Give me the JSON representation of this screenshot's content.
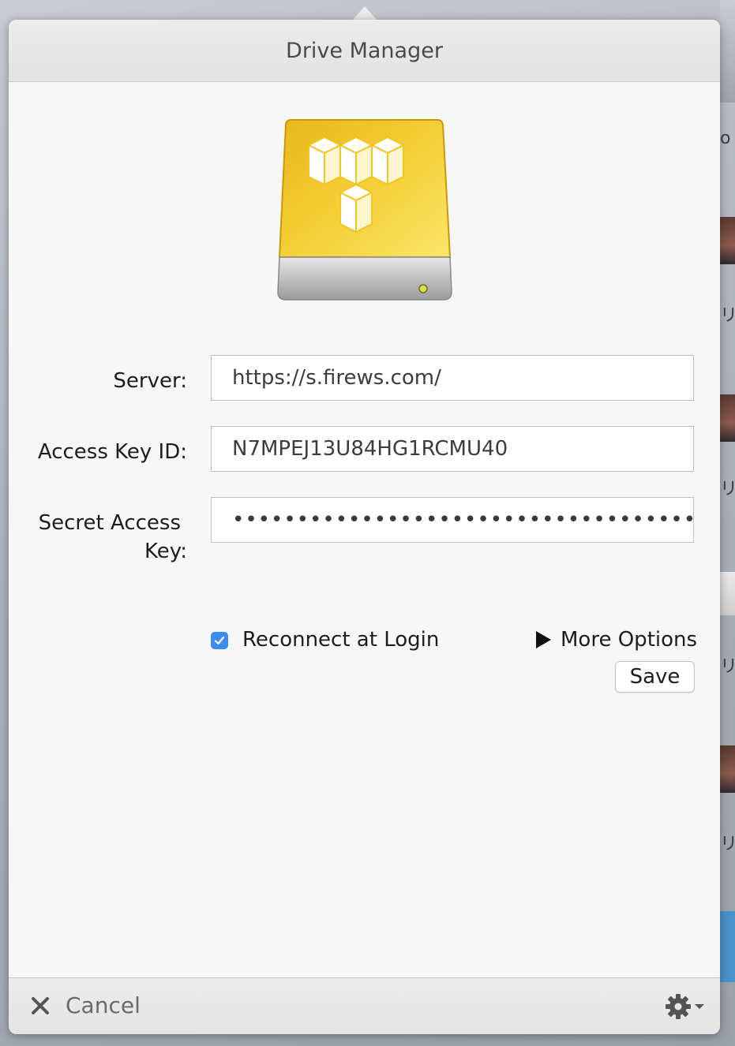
{
  "window": {
    "title": "Drive Manager"
  },
  "form": {
    "server": {
      "label": "Server:",
      "value": "https://s.firews.com/"
    },
    "access_key_id": {
      "label": "Access Key ID:",
      "value": "N7MPEJ13U84HG1RCMU40"
    },
    "secret_access_key": {
      "label_line1": "Secret Access",
      "label_line2": "Key:",
      "masked_value": "•••••••••••••••••••••••••••••••••••••"
    },
    "reconnect": {
      "label": "Reconnect at Login",
      "checked": true
    },
    "more_options": {
      "label": "More Options"
    },
    "save_label": "Save"
  },
  "footer": {
    "cancel_label": "Cancel"
  },
  "icons": {
    "drive": "drive-icon",
    "checkbox": "checkmark-icon",
    "disclosure": "disclosure-triangle-icon",
    "cancel": "close-icon",
    "settings": "gear-icon"
  },
  "colors": {
    "accent": "#3b8cf5",
    "drive_gold": "#f2c51f"
  }
}
